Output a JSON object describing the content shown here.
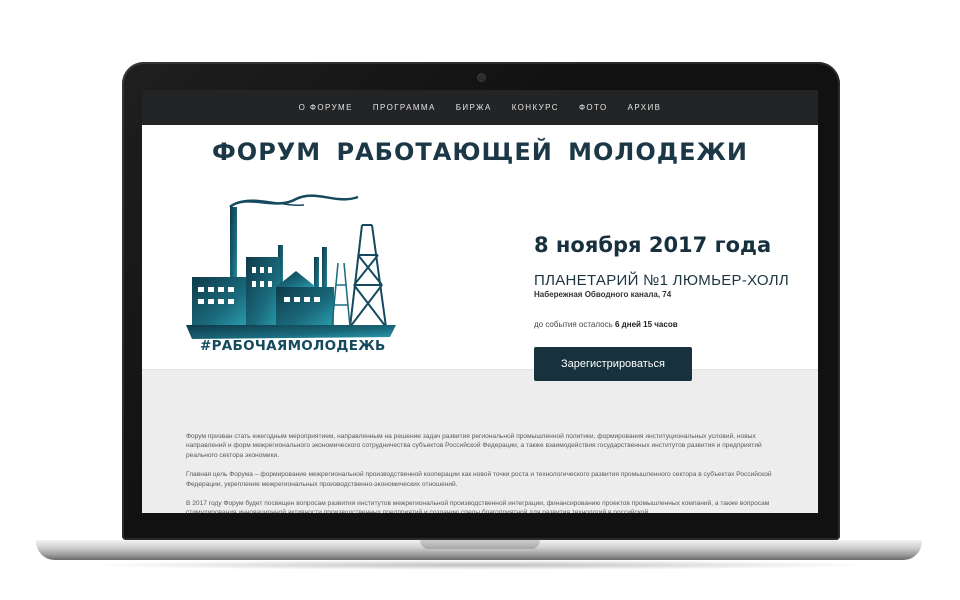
{
  "nav": {
    "items": [
      "О ФОРУМЕ",
      "ПРОГРАММА",
      "БИРЖА",
      "КОНКУРС",
      "ФОТО",
      "АРХИВ"
    ]
  },
  "hero": {
    "title": "ФОРУМ РАБОТАЮЩЕЙ МОЛОДЕЖИ",
    "hashtag": "#РАБОЧАЯМОЛОДЕЖЬ",
    "date": "8 ноября 2017 года",
    "venue": "ПЛАНЕТАРИЙ №1  ЛЮМЬЕР-ХОЛЛ",
    "address": "Набережная Обводного канала, 74",
    "countdown_prefix": "до события осталось",
    "countdown_value": "6 дней 15 часов",
    "register_label": "Зарегистрироваться"
  },
  "content": {
    "paragraphs": [
      "Форум призван стать ежегодным мероприятием, направленным на решение задач развития региональной промышленной политики, формирования институциональных условий, новых направлений и форм межрегионального экономического сотрудничества субъектов Российской Федерации, а также взаимодействия государственных институтов развития и предприятий реального сектора экономики.",
      "Главная цель Форума – формирование межрегиональной производственной кооперации как новой точки роста и технологического развития промышленного сектора в субъектах Российской Федерации, укрепление межрегиональных производственно-экономических отношений.",
      "В 2017 году Форум будет посвящен вопросам развития институтов межрегиональной производственной интеграции, финансированию проектов промышленных компаний, а также вопросам стимулирования инновационной активности производственных предприятий и созданию среды благоприятной для развития технологий в российской"
    ]
  },
  "colors": {
    "nav_bg": "#222426",
    "brand_dark": "#17323d",
    "logo_teal": "#14495e"
  }
}
